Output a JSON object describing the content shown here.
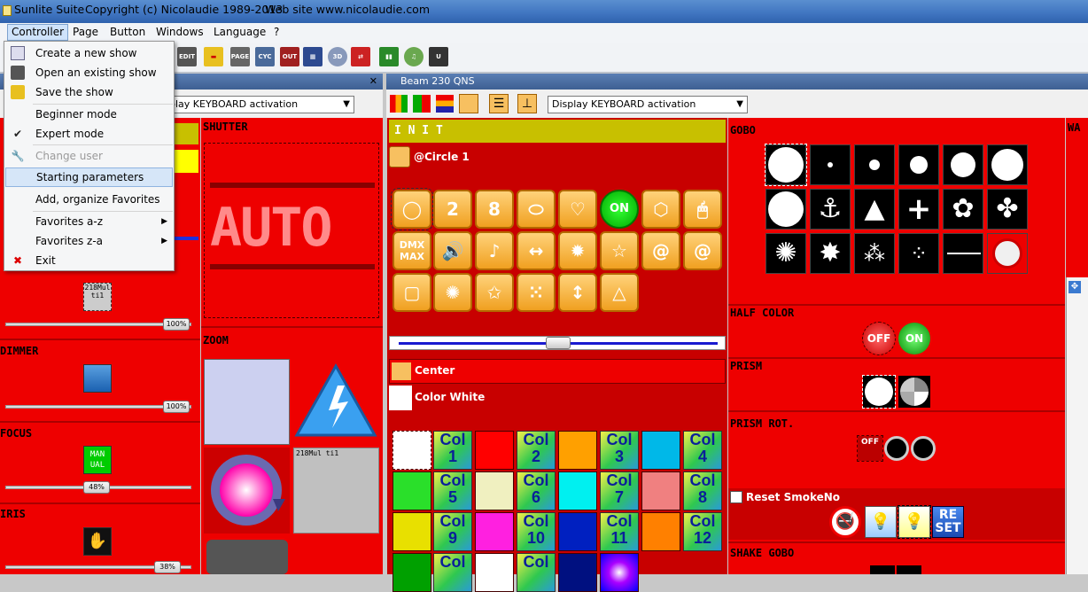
{
  "titlebar": {
    "app": "Sunlite Suite",
    "copyright": "Copyright (c) Nicolaudie 1989-2013",
    "website": "Web site www.nicolaudie.com"
  },
  "menubar": [
    "Controller",
    "Page",
    "Button",
    "Windows",
    "Language",
    "?"
  ],
  "dropdown": {
    "items": [
      {
        "label": "Create a new show",
        "icon": "new-show-icon",
        "state": "normal"
      },
      {
        "label": "Open an existing show",
        "icon": "open-show-icon",
        "state": "normal"
      },
      {
        "label": "Save the show",
        "icon": "save-show-icon",
        "state": "normal"
      },
      {
        "label": "Beginner mode",
        "icon": "",
        "state": "normal"
      },
      {
        "label": "Expert mode",
        "icon": "checkmark-icon",
        "state": "checked"
      },
      {
        "label": "Change user",
        "icon": "wrench-icon",
        "state": "disabled"
      },
      {
        "label": "Starting parameters",
        "icon": "",
        "state": "highlighted"
      },
      {
        "label": "Add, organize Favorites",
        "icon": "",
        "state": "normal"
      },
      {
        "label": "Favorites a-z",
        "icon": "",
        "state": "submenu"
      },
      {
        "label": "Favorites z-a",
        "icon": "",
        "state": "submenu"
      },
      {
        "label": "Exit",
        "icon": "exit-x-icon",
        "state": "normal"
      }
    ]
  },
  "left_panel": {
    "close_glyph": "✕",
    "select_value": "play KEYBOARD activation",
    "thumb1": "100%",
    "ticket_label": "218Mul ti1",
    "dimmer_title": "DIMMER",
    "thumb2": "100%",
    "focus_title": "FOCUS",
    "focus_btn": "MAN UAL",
    "thumb3": "48%",
    "iris_title": "IRIS",
    "thumb4": "38%"
  },
  "middle_panel": {
    "shutter_title": "SHUTTER",
    "auto_text": "AUTO",
    "zoom_title": "ZOOM",
    "multi_label": "218Mul ti1"
  },
  "beam_panel": {
    "title": "Beam 230 QNS",
    "select_value": "Display KEYBOARD activation",
    "init_title": "I N I T",
    "circle_label": "@Circle 1",
    "on_label": "ON",
    "dmx_label": "DMX MAX",
    "center_label": "Center",
    "color_white_label": "Color White",
    "col_buttons": [
      {
        "line1": "Col",
        "line2": "1"
      },
      {
        "line1": "Col",
        "line2": "2"
      },
      {
        "line1": "Col",
        "line2": "3"
      },
      {
        "line1": "Col",
        "line2": "4"
      },
      {
        "line1": "Col",
        "line2": "5"
      },
      {
        "line1": "Col",
        "line2": "6"
      },
      {
        "line1": "Col",
        "line2": "7"
      },
      {
        "line1": "Col",
        "line2": "8"
      },
      {
        "line1": "Col",
        "line2": "9"
      },
      {
        "line1": "Col",
        "line2": "10"
      },
      {
        "line1": "Col",
        "line2": "11"
      },
      {
        "line1": "Col",
        "line2": "12"
      },
      {
        "line1": "Col",
        "line2": ""
      },
      {
        "line1": "Col",
        "line2": ""
      }
    ]
  },
  "right_panel": {
    "gobo_title": "GOBO",
    "half_color_title": "HALF COLOR",
    "off_label": "OFF",
    "on_label": "ON",
    "prism_title": "PRISM",
    "prism_rot_title": "PRISM ROT.",
    "prism_rot_off": "OFF",
    "reset_label": "Reset SmokeNo",
    "reset_btn": "RE SET",
    "shake_gobo_title": "SHAKE GOBO",
    "edge_label": "WA"
  },
  "colors": {
    "panel_red": "#ee0000",
    "dark_red": "#c80000",
    "init_bar": "#c8c000",
    "accent_orange": "#f0a020"
  }
}
